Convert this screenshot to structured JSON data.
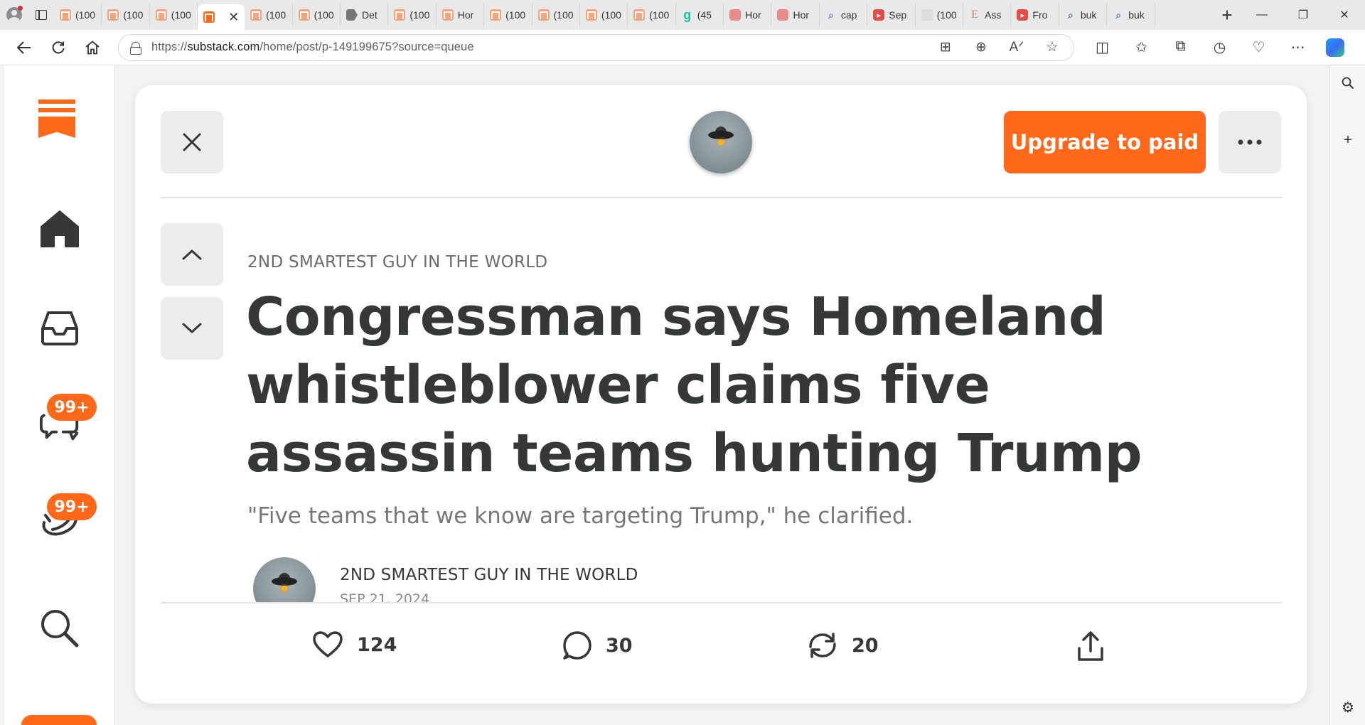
{
  "browser": {
    "tabs": [
      {
        "title": "(100",
        "icon": "substack-icon"
      },
      {
        "title": "(100",
        "icon": "substack-icon"
      },
      {
        "title": "(100",
        "icon": "substack-icon"
      },
      {
        "title": "",
        "icon": "substack-icon",
        "active": true
      },
      {
        "title": "(100",
        "icon": "substack-icon"
      },
      {
        "title": "(100",
        "icon": "substack-icon"
      },
      {
        "title": "Det",
        "icon": "arrow-icon"
      },
      {
        "title": "(100",
        "icon": "substack-icon"
      },
      {
        "title": "Hor",
        "icon": "substack-icon"
      },
      {
        "title": "(100",
        "icon": "substack-icon"
      },
      {
        "title": "(100",
        "icon": "substack-icon"
      },
      {
        "title": "(100",
        "icon": "substack-icon"
      },
      {
        "title": "(100",
        "icon": "substack-icon"
      },
      {
        "title": "(45",
        "icon": "grammarly-icon"
      },
      {
        "title": "Hor",
        "icon": "person-icon"
      },
      {
        "title": "Hor",
        "icon": "person-icon"
      },
      {
        "title": "cap",
        "icon": "search-icon"
      },
      {
        "title": "Sep",
        "icon": "youtube-icon"
      },
      {
        "title": "(100",
        "icon": "blank-icon"
      },
      {
        "title": "Ass",
        "icon": "letter-e-icon"
      },
      {
        "title": "Fro",
        "icon": "youtube-icon"
      },
      {
        "title": "buk",
        "icon": "search-icon"
      },
      {
        "title": "buk",
        "icon": "search-icon"
      }
    ],
    "url_prefix": "https://",
    "url_host": "substack.com",
    "url_path": "/home/post/p-149199675?source=queue"
  },
  "nav": {
    "chat_badge": "99+",
    "activity_badge": "99+"
  },
  "post": {
    "publication": "2ND SMARTEST GUY IN THE WORLD",
    "upgrade_label": "Upgrade to paid",
    "title": "Congressman says Homeland whistleblower claims five assassin teams hunting Trump",
    "subtitle": "\"Five teams that we know are targeting Trump,\" he clarified.",
    "author": "2ND SMARTEST GUY IN THE WORLD",
    "date": "SEP 21, 2024",
    "likes": "124",
    "comments": "30",
    "restacks": "20"
  },
  "colors": {
    "accent": "#ff6719",
    "text": "#363737",
    "muted": "#777777"
  }
}
